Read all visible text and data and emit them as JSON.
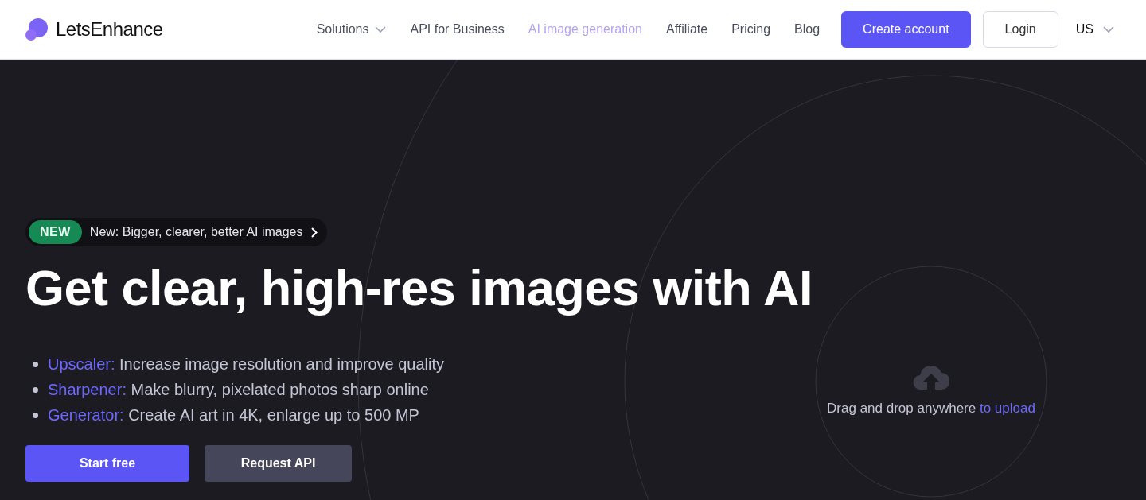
{
  "header": {
    "logo": "LetsEnhance",
    "nav": [
      {
        "label": "Solutions",
        "kind": "dropdown",
        "selected": false
      },
      {
        "label": "API for Business",
        "kind": "link",
        "selected": false
      },
      {
        "label": "AI image generation",
        "kind": "link",
        "selected": true
      },
      {
        "label": "Affiliate",
        "kind": "link",
        "selected": false
      },
      {
        "label": "Pricing",
        "kind": "link",
        "selected": false
      },
      {
        "label": "Blog",
        "kind": "link",
        "selected": false
      }
    ],
    "primary_button": "Create account",
    "secondary_button": "Login",
    "locale": "US"
  },
  "hero": {
    "badge": {
      "tag": "NEW",
      "text": "New: Bigger, clearer, better AI images"
    },
    "headline": "Get clear, high-res images with AI",
    "features": [
      {
        "label": "Upscaler:",
        "text": "Increase image resolution and improve quality"
      },
      {
        "label": "Sharpener:",
        "text": "Make blurry, pixelated photos sharp online"
      },
      {
        "label": "Generator:",
        "text": "Create AI art in 4K, enlarge up to 500 MP"
      }
    ],
    "buttons": [
      {
        "label": "Start free",
        "kind": "primary"
      },
      {
        "label": "Request API",
        "kind": "secondary"
      }
    ],
    "upload": {
      "text": "Drag and drop anywhere",
      "link": "to upload"
    }
  }
}
